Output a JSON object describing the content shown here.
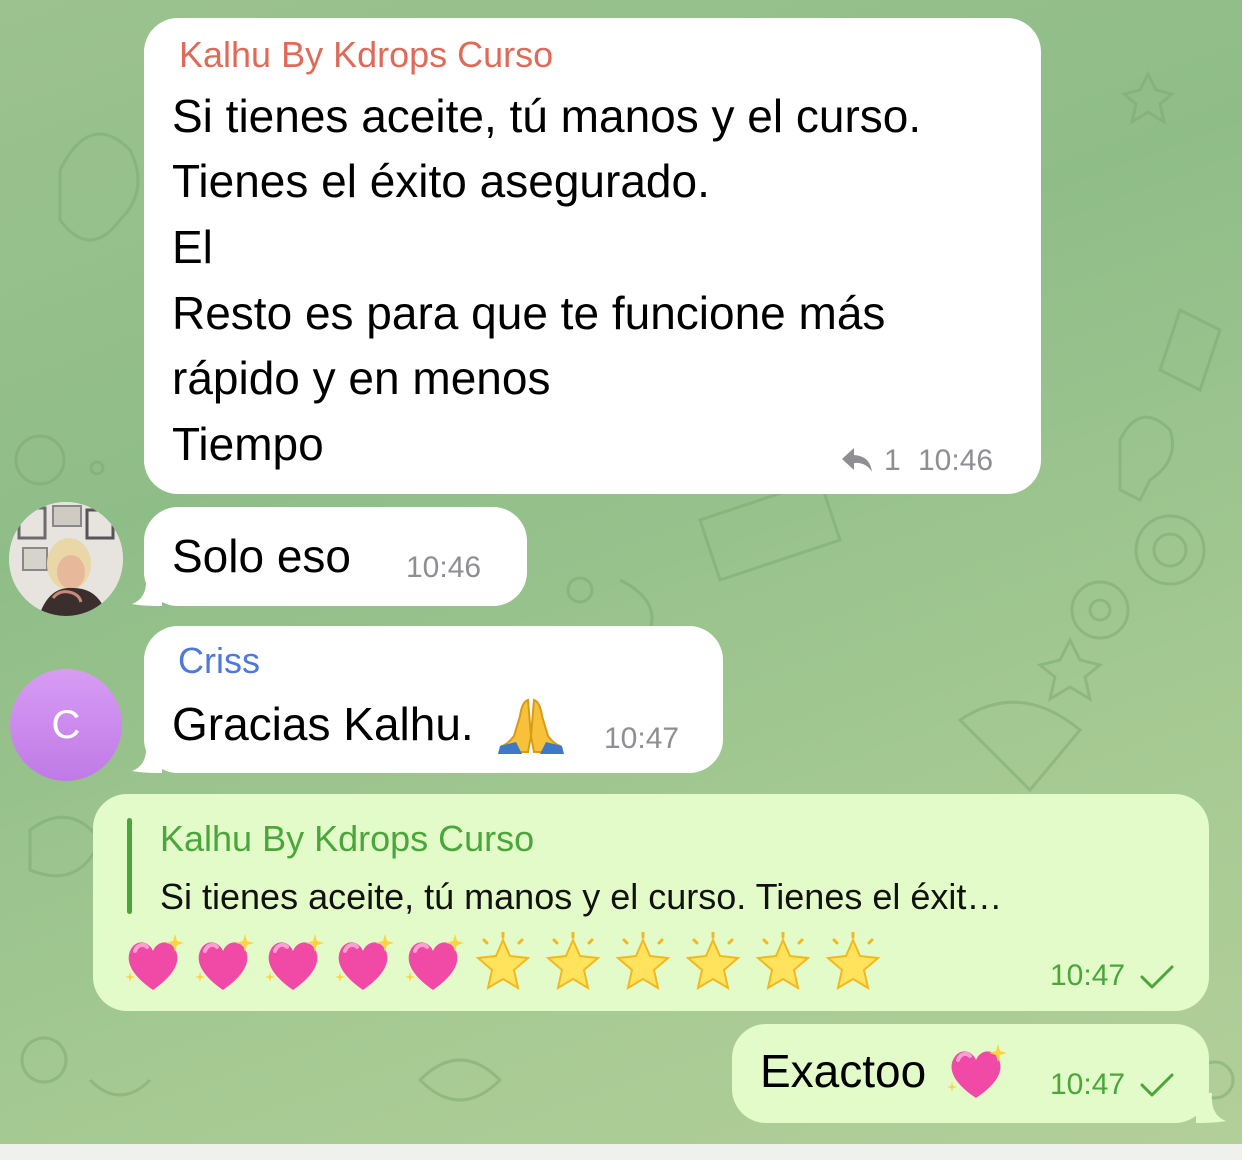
{
  "messages": {
    "m1": {
      "sender": "Kalhu By Kdrops Curso",
      "lines": [
        "Si tienes aceite, tú manos y el curso.",
        "Tienes el éxito asegurado.",
        "El",
        "Resto es para que te funcione más",
        "rápido y en menos",
        "Tiempo"
      ],
      "reply_count": "1",
      "time": "10:46"
    },
    "m2": {
      "text": "Solo eso",
      "time": "10:46"
    },
    "m3": {
      "sender": "Criss",
      "text": "Gracias Kalhu.",
      "time": "10:47",
      "avatar_letter": "C"
    },
    "m4": {
      "quote_title": "Kalhu By Kdrops Curso",
      "quote_text": "Si tienes aceite, tú manos y el curso.  Tienes el éxit…",
      "emojis": [
        "sparkling-heart",
        "sparkling-heart",
        "sparkling-heart",
        "sparkling-heart",
        "sparkling-heart",
        "glowing-star",
        "glowing-star",
        "glowing-star",
        "glowing-star",
        "glowing-star",
        "glowing-star"
      ],
      "time": "10:47"
    },
    "m5": {
      "text": "Exactoo",
      "time": "10:47"
    }
  },
  "colors": {
    "sender_kalhu": "#e06a58",
    "sender_criss": "#4d78dc",
    "outgoing_accent": "#4aa63b",
    "incoming_bubble": "#ffffff",
    "outgoing_bubble": "#e2fbc8"
  }
}
